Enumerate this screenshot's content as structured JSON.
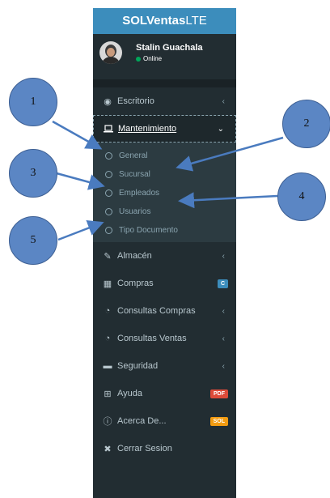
{
  "brand": {
    "bold": "SOLVentas",
    "light": "LTE"
  },
  "user": {
    "name": "Stalin Guachala",
    "status": "Online"
  },
  "menu": {
    "escritorio": "Escritorio",
    "mantenimiento": "Mantenimiento",
    "sub": [
      "General",
      "Sucursal",
      "Empleados",
      "Usuarios",
      "Tipo Documento"
    ],
    "almacen": "Almacén",
    "compras": "Compras",
    "compras_badge": "C",
    "consultas_compras": "Consultas Compras",
    "consultas_ventas": "Consultas Ventas",
    "seguridad": "Seguridad",
    "ayuda": "Ayuda",
    "ayuda_badge": "PDF",
    "acerca": "Acerca De...",
    "acerca_badge": "SOL",
    "cerrar": "Cerrar Sesion"
  },
  "callouts": [
    "1",
    "2",
    "3",
    "4",
    "5"
  ],
  "colors": {
    "sidebar": "#222d32",
    "logo": "#3c8dbc",
    "callout": "#5b86c4",
    "badge_blue": "#3c8dbc",
    "badge_red": "#dd4b39",
    "badge_orange": "#f39c12"
  }
}
